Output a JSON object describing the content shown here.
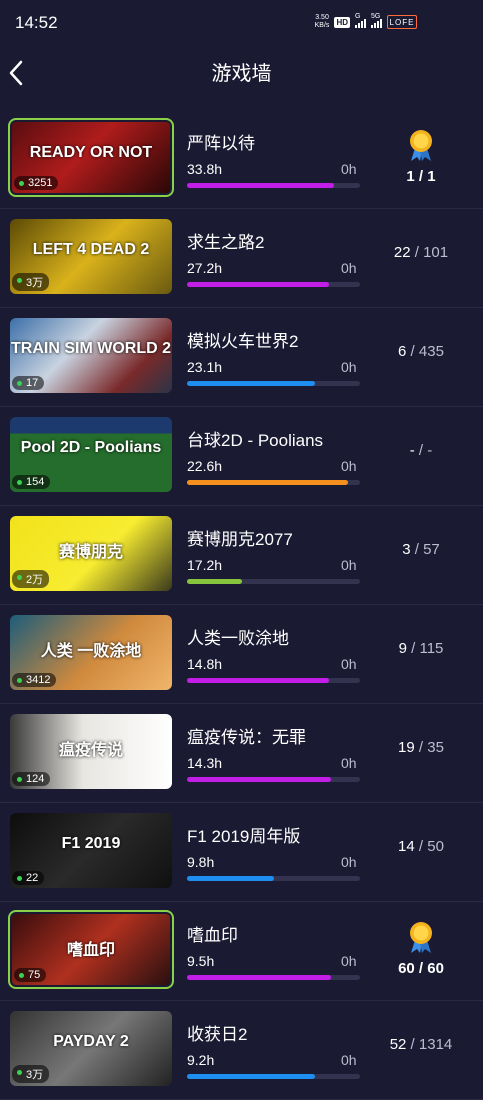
{
  "status_bar": {
    "time": "14:52",
    "speed_value": "3.50",
    "speed_unit": "KB/s",
    "hd_label": "HD",
    "signal1_label": "G",
    "signal2_label": "5G",
    "battery_label": "LOFE"
  },
  "header": {
    "title": "游戏墙",
    "back_icon": "chevron-left-icon"
  },
  "colors": {
    "background": "#1b1a33",
    "purple": "#c21ee8",
    "blue": "#1e8ef0",
    "orange": "#f5901e",
    "green": "#86c43c"
  },
  "games": [
    {
      "name": "严阵以待",
      "hours": "33.8h",
      "recent": "0h",
      "players": "3251",
      "progress": 0.85,
      "bar_color": "#c21ee8",
      "achievements": "1 / 1",
      "achieved": "1",
      "total": "1",
      "perfect": true,
      "thumb_text": "READY OR NOT",
      "thumb_bg": "linear-gradient(135deg,#5a0d10,#b01c1c 45%,#2a0707)"
    },
    {
      "name": "求生之路2",
      "hours": "27.2h",
      "recent": "0h",
      "players": "3万",
      "progress": 0.82,
      "bar_color": "#c21ee8",
      "achieved": "22",
      "total": "101",
      "perfect": false,
      "thumb_text": "LEFT 4 DEAD 2",
      "thumb_bg": "linear-gradient(135deg,#5c4a06,#d9b21b 50%,#6a5a10)"
    },
    {
      "name": "模拟火车世界2",
      "hours": "23.1h",
      "recent": "0h",
      "players": "17",
      "progress": 0.74,
      "bar_color": "#1e8ef0",
      "achieved": "6",
      "total": "435",
      "perfect": false,
      "thumb_text": "TRAIN SIM WORLD 2",
      "thumb_bg": "linear-gradient(135deg,#3c6fa8,#c9d3e0 40%,#7a2a2a 75%,#2b3447)"
    },
    {
      "name": "台球2D - Poolians",
      "hours": "22.6h",
      "recent": "0h",
      "players": "154",
      "progress": 0.93,
      "bar_color": "#f5901e",
      "achieved": "-",
      "total": "-",
      "perfect": false,
      "thumb_text": "Pool 2D - Poolians",
      "thumb_bg": "linear-gradient(180deg,#1d3a6e 0 22%,#256d2c 22% 100%)"
    },
    {
      "name": "赛博朋克2077",
      "hours": "17.2h",
      "recent": "0h",
      "players": "2万",
      "progress": 0.32,
      "bar_color": "#86c43c",
      "achieved": "3",
      "total": "57",
      "perfect": false,
      "thumb_text": "赛博朋克",
      "thumb_bg": "linear-gradient(135deg,#f1e21a,#f7ec30 55%,#3b3a1c)"
    },
    {
      "name": "人类一败涂地",
      "hours": "14.8h",
      "recent": "0h",
      "players": "3412",
      "progress": 0.82,
      "bar_color": "#c21ee8",
      "achieved": "9",
      "total": "115",
      "perfect": false,
      "thumb_text": "人类 一败涂地",
      "thumb_bg": "linear-gradient(135deg,#1d5d7a,#d08a3e 55%,#f0b56a)"
    },
    {
      "name": "瘟疫传说：无罪",
      "hours": "14.3h",
      "recent": "0h",
      "players": "124",
      "progress": 0.83,
      "bar_color": "#c21ee8",
      "achieved": "19",
      "total": "35",
      "perfect": false,
      "thumb_text": "瘟疫传说",
      "thumb_bg": "linear-gradient(90deg,#3a3a3a,#e8e6e1 45%,#ffffff)"
    },
    {
      "name": "F1 2019周年版",
      "hours": "9.8h",
      "recent": "0h",
      "players": "22",
      "progress": 0.5,
      "bar_color": "#1e8ef0",
      "achieved": "14",
      "total": "50",
      "perfect": false,
      "thumb_text": "F1 2019",
      "thumb_bg": "linear-gradient(135deg,#0d0d0d,#2a2a2a 50%,#101010)"
    },
    {
      "name": "嗜血印",
      "hours": "9.5h",
      "recent": "0h",
      "players": "75",
      "progress": 0.83,
      "bar_color": "#c21ee8",
      "achievements": "60 / 60",
      "achieved": "60",
      "total": "60",
      "perfect": true,
      "thumb_text": "嗜血印",
      "thumb_bg": "linear-gradient(135deg,#3a0d0d,#b0301f 50%,#2a1010)"
    },
    {
      "name": "收获日2",
      "hours": "9.2h",
      "recent": "0h",
      "players": "3万",
      "progress": 0.74,
      "bar_color": "#1e8ef0",
      "achieved": "52",
      "total": "1314",
      "perfect": false,
      "thumb_text": "PAYDAY 2",
      "thumb_bg": "linear-gradient(135deg,#333,#777 50%,#222)"
    }
  ]
}
